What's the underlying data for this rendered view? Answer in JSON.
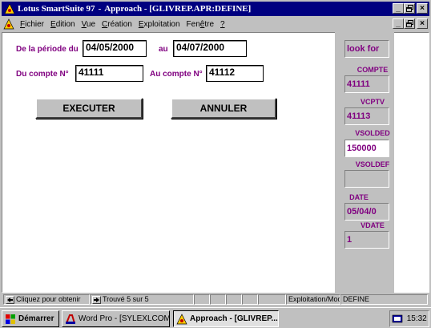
{
  "window": {
    "app_name": "Lotus SmartSuite 97",
    "separator": "-",
    "document_title": "Approach - [GLIVREP.APR:DEFINE]",
    "min_label": "_",
    "max_label": " ",
    "close_label": "×"
  },
  "menu": [
    {
      "key": "F",
      "rest": "ichier"
    },
    {
      "key": "E",
      "rest": "dition"
    },
    {
      "key": "V",
      "rest": "ue"
    },
    {
      "key": "C",
      "rest": "réation"
    },
    {
      "key": "E",
      "rest": "xploitation"
    },
    {
      "key": "",
      "rest": "Fen",
      "key2": "ê",
      "rest2": "tre"
    },
    {
      "key": "?",
      "rest": ""
    }
  ],
  "form": {
    "period_from_label": "De la période du",
    "period_from_value": "04/05/2000",
    "period_to_label": "au",
    "period_to_value": "04/07/2000",
    "account_from_label": "Du compte N°",
    "account_from_value": "41111",
    "account_to_label": "Au compte N°",
    "account_to_value": "41112",
    "execute_label": "EXECUTER",
    "cancel_label": "ANNULER"
  },
  "panel": {
    "lookfor_value": "look for",
    "compte_label": "COMPTE",
    "compte_value": "41111",
    "vcptv_label": "VCPTV",
    "vcptv_value": "41113",
    "vsolded_label": "VSOLDED",
    "vsolded_value": "150000",
    "vsoldef_label": "VSOLDEF",
    "vsoldef_value": "",
    "date_label": "DATE",
    "date_value": "05/04/0",
    "vdate_label": "VDATE",
    "vdate_value": "1"
  },
  "status": {
    "hint": "Cliquez pour obtenir",
    "found": "Trouvé 5 sur 5",
    "mode": "Exploitation/Modifié",
    "view": "DEFINE"
  },
  "taskbar": {
    "start_label": "Démarrer",
    "task1_label": "Word Pro - [SYLEXLCOM...",
    "task2_label": "Approach - [GLIVREP...",
    "clock": "15:32"
  },
  "colors": {
    "title_bar": "#000080",
    "label_purple": "#800080",
    "face": "#c0c0c0"
  }
}
